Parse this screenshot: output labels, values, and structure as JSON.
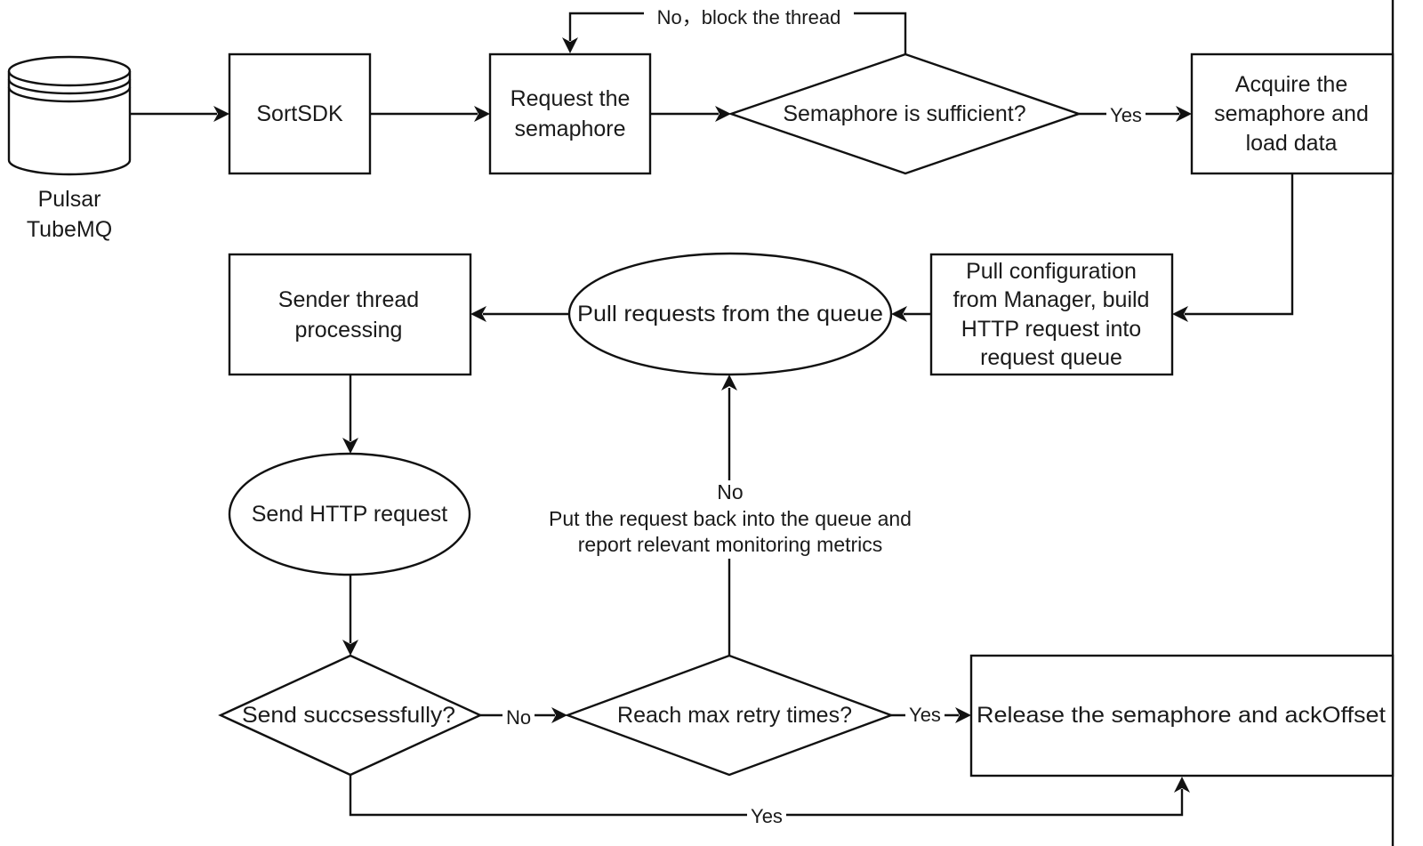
{
  "diagram": {
    "type": "flowchart",
    "colors": {
      "stroke": "#111111",
      "fill": "#ffffff",
      "text": "#1a1a1a"
    },
    "nodes": {
      "source": {
        "shape": "database-cylinder",
        "label": [
          "Pulsar",
          "TubeMQ"
        ]
      },
      "sortsdk": {
        "shape": "rectangle",
        "label": [
          "SortSDK"
        ]
      },
      "request_semaphore": {
        "shape": "rectangle",
        "label": [
          "Request the",
          "semaphore"
        ]
      },
      "semaphore_sufficient": {
        "shape": "diamond",
        "label": [
          "Semaphore is sufficient?"
        ]
      },
      "acquire_load": {
        "shape": "rectangle",
        "label": [
          "Acquire the",
          "semaphore and",
          "load data"
        ]
      },
      "pull_config": {
        "shape": "rectangle",
        "label": [
          "Pull configuration",
          "from Manager, build",
          "HTTP request into",
          "request queue"
        ]
      },
      "pull_requests": {
        "shape": "ellipse",
        "label": [
          "Pull requests from the queue"
        ]
      },
      "sender_thread": {
        "shape": "rectangle",
        "label": [
          "Sender thread",
          "processing"
        ]
      },
      "send_http": {
        "shape": "ellipse",
        "label": [
          "Send HTTP request"
        ]
      },
      "send_success": {
        "shape": "diamond",
        "label": [
          "Send succsessfully?"
        ]
      },
      "max_retry": {
        "shape": "diamond",
        "label": [
          "Reach max retry times?"
        ]
      },
      "release": {
        "shape": "rectangle",
        "label": [
          "Release the semaphore and ackOffset"
        ]
      }
    },
    "edges": [
      {
        "from": "source",
        "to": "sortsdk",
        "label": ""
      },
      {
        "from": "sortsdk",
        "to": "request_semaphore",
        "label": ""
      },
      {
        "from": "request_semaphore",
        "to": "semaphore_sufficient",
        "label": ""
      },
      {
        "from": "semaphore_sufficient",
        "to": "request_semaphore",
        "label": "No，block the thread"
      },
      {
        "from": "semaphore_sufficient",
        "to": "acquire_load",
        "label": "Yes"
      },
      {
        "from": "acquire_load",
        "to": "pull_config",
        "label": ""
      },
      {
        "from": "pull_config",
        "to": "pull_requests",
        "label": ""
      },
      {
        "from": "pull_requests",
        "to": "sender_thread",
        "label": ""
      },
      {
        "from": "sender_thread",
        "to": "send_http",
        "label": ""
      },
      {
        "from": "send_http",
        "to": "send_success",
        "label": ""
      },
      {
        "from": "send_success",
        "to": "max_retry",
        "label": "No"
      },
      {
        "from": "max_retry",
        "to": "release",
        "label": "Yes"
      },
      {
        "from": "max_retry",
        "to": "pull_requests",
        "label": "No",
        "note": [
          "Put the request back into the queue and",
          "report relevant monitoring metrics"
        ]
      },
      {
        "from": "send_success",
        "to": "release",
        "label": "Yes"
      }
    ]
  }
}
